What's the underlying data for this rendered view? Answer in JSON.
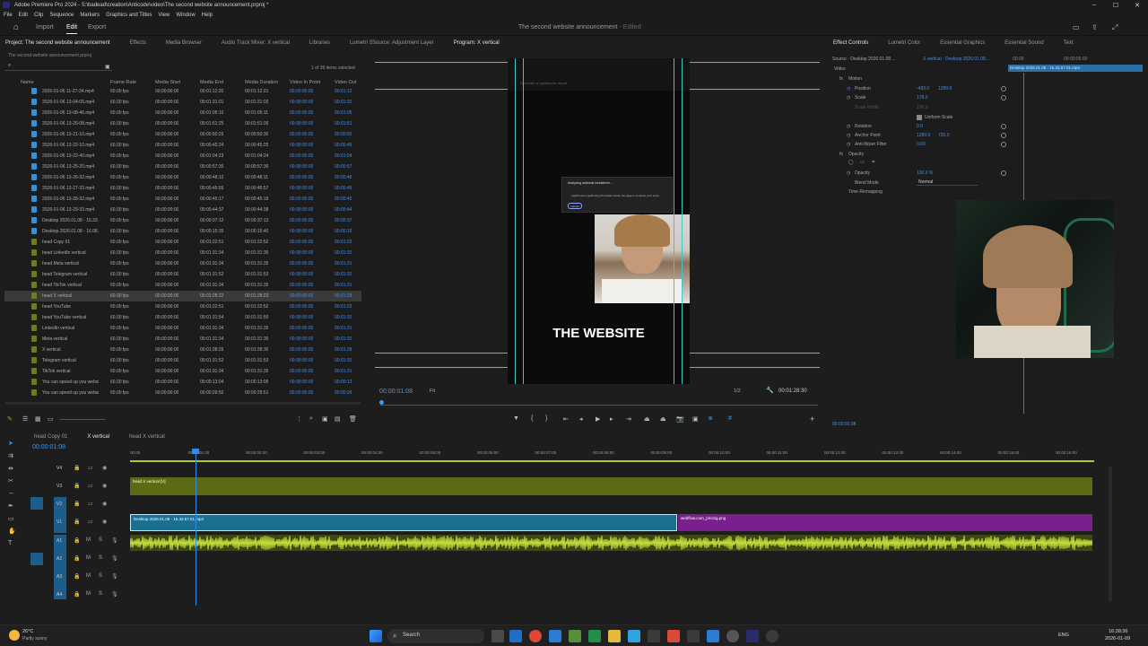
{
  "app": {
    "title": "Adobe Premiere Pro 2024 - S:\\badead\\creation\\Anticode\\video\\The second website announcement.prproj *",
    "window_controls": [
      "–",
      "☐",
      "✕"
    ]
  },
  "menu": [
    "File",
    "Edit",
    "Clip",
    "Sequence",
    "Markers",
    "Graphics and Titles",
    "View",
    "Window",
    "Help"
  ],
  "workspace": {
    "tabs": [
      "Import",
      "Edit",
      "Export"
    ],
    "active": "Edit",
    "doc_title": "The second website announcement",
    "doc_status": "- Edited"
  },
  "project_panel": {
    "tabs": [
      "Project: The second website announcement",
      "Effects",
      "Media Browser",
      "Audio Track Mixer: X vertical",
      "Libraries",
      "Lumetri S"
    ],
    "bin_path": "The second website announcement.prproj",
    "items_selected": "1 of 39 items selected",
    "columns": [
      "Name",
      "Frame Rate",
      "Media Start",
      "Media End",
      "Media Duration",
      "Video In Point",
      "Video Out"
    ],
    "rows": [
      {
        "name": "2026-01-06 11-27-34.mp4",
        "fps": "60.00 fps",
        "start": "00:00:00:00",
        "end": "00:01:12:20",
        "dur": "00:01:12:21",
        "in": "00:00:00:00",
        "out": "00:01:12",
        "type": "video"
      },
      {
        "name": "2026-01-06 13-04-05.mp4",
        "fps": "60.00 fps",
        "start": "00:00:00:00",
        "end": "00:01:31:01",
        "dur": "00:01:31:02",
        "in": "00:00:00:00",
        "out": "00:01:31",
        "type": "video"
      },
      {
        "name": "2026-01-06 13-08-46.mp4",
        "fps": "60.00 fps",
        "start": "00:00:00:00",
        "end": "00:01:05:10",
        "dur": "00:01:05:11",
        "in": "00:00:00:00",
        "out": "00:01:05",
        "type": "video"
      },
      {
        "name": "2026-01-06 13-20-08.mp4",
        "fps": "60.00 fps",
        "start": "00:00:00:00",
        "end": "00:01:51:25",
        "dur": "00:01:51:26",
        "in": "00:00:00:00",
        "out": "00:01:51",
        "type": "video"
      },
      {
        "name": "2026-01-06 13-21-10.mp4",
        "fps": "60.00 fps",
        "start": "00:00:00:00",
        "end": "00:00:50:29",
        "dur": "00:00:50:30",
        "in": "00:00:00:00",
        "out": "00:00:50",
        "type": "video"
      },
      {
        "name": "2026-01-06 13-22-10.mp4",
        "fps": "60.00 fps",
        "start": "00:00:00:00",
        "end": "00:00:45:24",
        "dur": "00:00:45:25",
        "in": "00:00:00:00",
        "out": "00:00:45",
        "type": "video"
      },
      {
        "name": "2026-01-06 13-22-40.mp4",
        "fps": "60.00 fps",
        "start": "00:00:00:00",
        "end": "00:01:04:23",
        "dur": "00:01:04:24",
        "in": "00:00:00:00",
        "out": "00:01:04",
        "type": "video"
      },
      {
        "name": "2026-01-06 13-25-20.mp4",
        "fps": "60.00 fps",
        "start": "00:00:00:00",
        "end": "00:00:57:35",
        "dur": "00:00:57:36",
        "in": "00:00:00:00",
        "out": "00:00:57",
        "type": "video"
      },
      {
        "name": "2026-01-06 13-26-32.mp4",
        "fps": "60.00 fps",
        "start": "00:00:00:00",
        "end": "00:00:48:10",
        "dur": "00:00:48:11",
        "in": "00:00:00:00",
        "out": "00:00:48",
        "type": "video"
      },
      {
        "name": "2026-01-06 13-27-33.mp4",
        "fps": "60.00 fps",
        "start": "00:00:00:00",
        "end": "00:00:45:56",
        "dur": "00:00:45:57",
        "in": "00:00:00:00",
        "out": "00:00:45",
        "type": "video"
      },
      {
        "name": "2026-01-06 13-28-32.mp4",
        "fps": "60.00 fps",
        "start": "00:00:00:00",
        "end": "00:00:45:17",
        "dur": "00:00:45:18",
        "in": "00:00:00:00",
        "out": "00:00:45",
        "type": "video"
      },
      {
        "name": "2026-01-06 13-29-33.mp4",
        "fps": "60.00 fps",
        "start": "00:00:00:00",
        "end": "00:00:44:37",
        "dur": "00:00:44:38",
        "in": "00:00:00:00",
        "out": "00:00:44",
        "type": "video"
      },
      {
        "name": "Desktop 2026.01.08 - 15.33.",
        "fps": "60.00 fps",
        "start": "00:00:00:00",
        "end": "00:00:37:12",
        "dur": "00:00:37:13",
        "in": "00:00:00:00",
        "out": "00:00:37",
        "type": "video"
      },
      {
        "name": "Desktop 2026.01.08 - 16.08.",
        "fps": "60.00 fps",
        "start": "00:00:00:00",
        "end": "00:00:15:39",
        "dur": "00:00:15:40",
        "in": "00:00:00:00",
        "out": "00:00:15",
        "type": "video"
      },
      {
        "name": "head Copy 01",
        "fps": "60.00 fps",
        "start": "00:00:00:00",
        "end": "00:01:22:51",
        "dur": "00:01:22:52",
        "in": "00:00:00:00",
        "out": "00:01:22",
        "type": "seq"
      },
      {
        "name": "head LinkedIn vertical",
        "fps": "60.00 fps",
        "start": "00:00:00:00",
        "end": "00:01:31:34",
        "dur": "00:01:31:35",
        "in": "00:00:00:00",
        "out": "00:01:31",
        "type": "seq"
      },
      {
        "name": "head Meta vertical",
        "fps": "60.00 fps",
        "start": "00:00:00:00",
        "end": "00:01:31:34",
        "dur": "00:01:31:35",
        "in": "00:00:00:00",
        "out": "00:01:31",
        "type": "seq"
      },
      {
        "name": "head Telegram vertical",
        "fps": "60.00 fps",
        "start": "00:00:00:00",
        "end": "00:01:31:52",
        "dur": "00:01:31:53",
        "in": "00:00:00:00",
        "out": "00:01:31",
        "type": "seq"
      },
      {
        "name": "head TikTok vertical",
        "fps": "60.00 fps",
        "start": "00:00:00:00",
        "end": "00:01:31:34",
        "dur": "00:01:31:35",
        "in": "00:00:00:00",
        "out": "00:01:31",
        "type": "seq"
      },
      {
        "name": "head X vertical",
        "fps": "60.00 fps",
        "start": "00:00:00:00",
        "end": "00:01:28:22",
        "dur": "00:01:28:23",
        "in": "00:00:00:00",
        "out": "00:01:28",
        "type": "seq",
        "selected": true
      },
      {
        "name": "head YouTube",
        "fps": "60.00 fps",
        "start": "00:00:00:00",
        "end": "00:01:22:51",
        "dur": "00:01:22:52",
        "in": "00:00:00:00",
        "out": "00:01:22",
        "type": "seq"
      },
      {
        "name": "head YouTube vertical",
        "fps": "60.00 fps",
        "start": "00:00:00:00",
        "end": "00:01:31:54",
        "dur": "00:01:31:55",
        "in": "00:00:00:00",
        "out": "00:01:31",
        "type": "seq"
      },
      {
        "name": "LinkedIn vertical",
        "fps": "60.00 fps",
        "start": "00:00:00:00",
        "end": "00:01:31:34",
        "dur": "00:01:31:35",
        "in": "00:00:00:00",
        "out": "00:01:31",
        "type": "seq"
      },
      {
        "name": "Meta vertical",
        "fps": "60.00 fps",
        "start": "00:00:00:00",
        "end": "00:01:31:34",
        "dur": "00:01:31:35",
        "in": "00:00:00:00",
        "out": "00:01:31",
        "type": "seq"
      },
      {
        "name": "X vertical",
        "fps": "60.00 fps",
        "start": "00:00:00:00",
        "end": "00:01:28:29",
        "dur": "00:01:28:30",
        "in": "00:00:00:00",
        "out": "00:01:28",
        "type": "seq"
      },
      {
        "name": "Telegram vertical",
        "fps": "60.00 fps",
        "start": "00:00:00:00",
        "end": "00:01:31:52",
        "dur": "00:01:31:53",
        "in": "00:00:00:00",
        "out": "00:01:31",
        "type": "seq"
      },
      {
        "name": "TikTok vertical",
        "fps": "60.00 fps",
        "start": "00:00:00:00",
        "end": "00:01:31:34",
        "dur": "00:01:31:35",
        "in": "00:00:00:00",
        "out": "00:01:31",
        "type": "seq"
      },
      {
        "name": "You can speed up you websi",
        "fps": "60.00 fps",
        "start": "00:00:00:00",
        "end": "00:00:13:04",
        "dur": "00:00:13:05",
        "in": "00:00:00:00",
        "out": "00:00:13",
        "type": "seq"
      },
      {
        "name": "You can speed up you websi",
        "fps": "60.00 fps",
        "start": "00:00:00:00",
        "end": "00:00:29:50",
        "dur": "00:00:29:51",
        "in": "00:00:00:00",
        "out": "00:00:29",
        "type": "seq"
      }
    ]
  },
  "program_monitor": {
    "tabs": [
      "Source: Adjustment Layer",
      "Program: X vertical"
    ],
    "timecode": "00:00:01:08",
    "fit": "Fit",
    "resolution": "1/2",
    "duration": "00:01:28:30",
    "overlay_text": "THE WEBSITE",
    "web_dialog_title": "Analyzing anticode.website/en...",
    "web_dialog_body": "Lighthouse is gathering information about the page to compute your score.",
    "web_dialog_button": "Cancel",
    "web_header": "Generate a Lighthouse report"
  },
  "effect_controls": {
    "tabs": [
      "Effect Controls",
      "Lumetri Color",
      "Essential Graphics",
      "Essential Sound",
      "Text"
    ],
    "source": "Source · Desktop 2026.01.08 ...",
    "sequence": "X vertical · Desktop 2026.01.08...",
    "clip_label": "Desktop 2026.01.08 - 15.33.57.01.mp4",
    "section_video": "Video",
    "motion": "Motion",
    "position_label": "Position",
    "position_x": "-493.0",
    "position_y": "1280.0",
    "scale_label": "Scale",
    "scale_value": "178.0",
    "scale_width_label": "Scale Width",
    "scale_width_value": "100.0",
    "uniform_scale": "Uniform Scale",
    "rotation_label": "Rotation",
    "rotation_value": "0.0",
    "anchor_label": "Anchor Point",
    "anchor_x": "1280.0",
    "anchor_y": "720.0",
    "antiflicker_label": "Anti-flicker Filter",
    "antiflicker_value": "0.00",
    "opacity_section": "Opacity",
    "opacity_label": "Opacity",
    "opacity_value": "100.0 %",
    "blend_label": "Blend Mode",
    "blend_value": "Normal",
    "time_remap": "Time Remapping",
    "bottom_timecode": "00:00:01:08",
    "ruler_start": "00:00",
    "ruler_mid": "00:00:05:00"
  },
  "timeline": {
    "tabs": [
      "head Copy 01",
      "X vertical",
      "head X vertical"
    ],
    "timecode": "00:00:01:08",
    "ruler": [
      "00:00",
      "00:00:01:00",
      "00:00:02:00",
      "00:00:03:00",
      "00:00:04:00",
      "00:00:05:00",
      "00:00:06:00",
      "00:00:07:00",
      "00:00:08:00",
      "00:00:09:00",
      "00:00:10:00",
      "00:00:11:00",
      "00:00:12:00",
      "00:00:13:00",
      "00:00:14:00",
      "00:00:15:00",
      "00:00:16:00"
    ],
    "tracks_video": [
      "V4",
      "V3",
      "V2",
      "V1"
    ],
    "tracks_audio": [
      "A1",
      "A2",
      "A3",
      "A4"
    ],
    "clip_v3": "head X vertical [V]",
    "clip_v1a": "Desktop 2026.01.08 - 15.33.57.01.mp4",
    "clip_v1b": "webflow.com_pricing.png"
  },
  "taskbar": {
    "weather_temp": "26°C",
    "weather_desc": "Partly sunny",
    "search_label": "Search",
    "lang": "ENG",
    "time": "16:38:36",
    "date": "2026-01-09"
  },
  "colors": {
    "accent_blue": "#2d8ceb",
    "clip_olive": "#5c6a14",
    "clip_teal": "#1b6f8f",
    "clip_purple": "#7a1f8e",
    "audio_green": "#9bb82a"
  }
}
